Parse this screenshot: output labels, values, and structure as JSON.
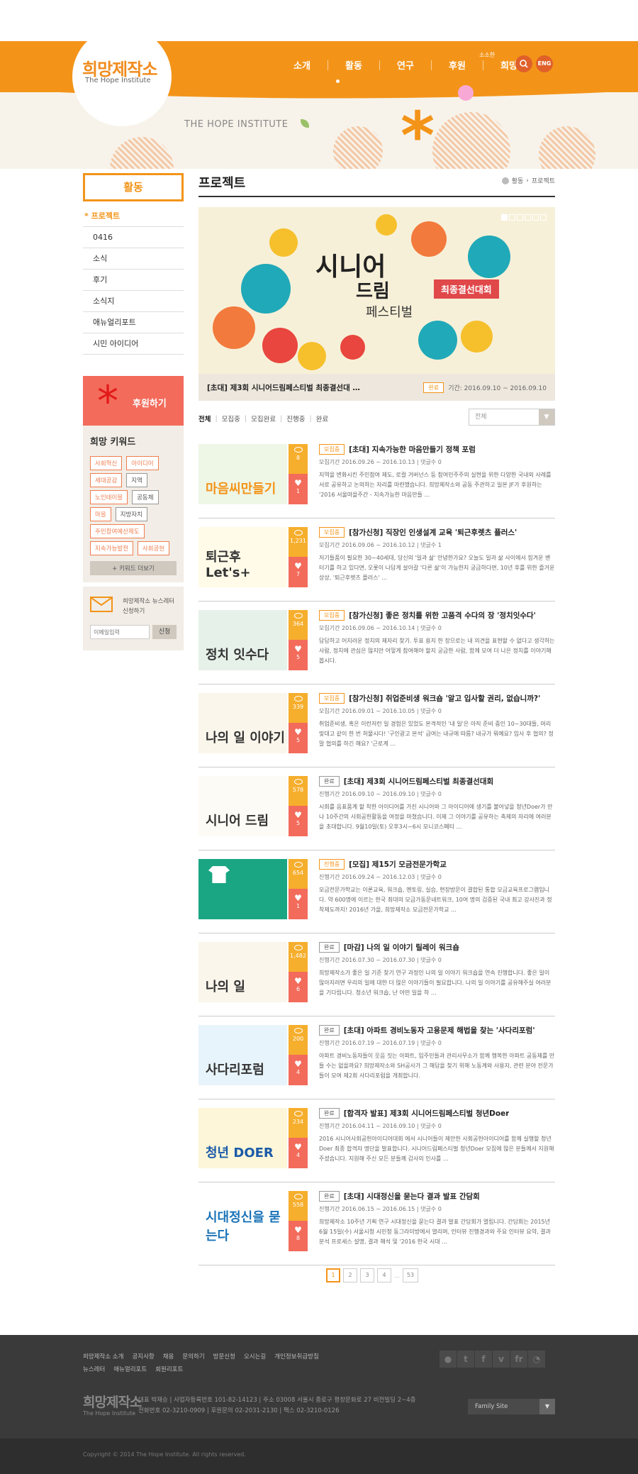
{
  "header": {
    "logo": "희망제작소",
    "logo_sub": "The Hope Institute",
    "nav": [
      "소개",
      "활동",
      "연구",
      "후원"
    ],
    "nav_small": "소소한",
    "nav_last": "희망",
    "search_icon": "search-icon",
    "lang": "ENG",
    "banner": "THE HOPE INSTITUTE"
  },
  "sidebar": {
    "title": "활동",
    "items": [
      "프로젝트",
      "0416",
      "소식",
      "후기",
      "소식지",
      "애뉴얼리포트",
      "시민 아이디어"
    ],
    "support": "후원하기",
    "keyword_title": "희망 키워드",
    "keywords": [
      "사회혁신",
      "아이디어",
      "세대공감",
      "지역",
      "노인테이블",
      "공동체",
      "마을",
      "지방자치",
      "주민참여예산제도",
      "지속가능발전",
      "사회공헌"
    ],
    "more_keywords": "+ 키워드 더보기",
    "newsletter": "희망제작소 뉴스레터 신청하기",
    "email_placeholder": "이메일입력",
    "subscribe": "신청"
  },
  "content": {
    "title": "프로젝트",
    "breadcrumb": [
      "활동",
      "프로젝트"
    ],
    "slider": {
      "main": "시니어",
      "sub": "드림",
      "sub2": "페스티벌",
      "badge": "최종결선대회",
      "caption": "[초대] 제3회 시니어드림페스티벌 최종결선대 …",
      "status": "완료",
      "period": "기간: 2016.09.10 ~ 2016.09.10"
    },
    "filters": [
      "전체",
      "모집중",
      "모집완료",
      "진행중",
      "완료"
    ],
    "filter_select": "전체",
    "posts": [
      {
        "status": "모집중",
        "title": "[초대] 지속가능한 마음만들기 정책 포럼",
        "meta": "모집기간 2016.09.26 ~ 2016.10.13  |  댓글수 0",
        "desc": "지역을 변화시킨 주민참여 제도, 로컬 거버넌스 등 참여민주주의 실현을 위한 다양한 국내외 사례를 서로 공유하고 논의하는 자리를 마련했습니다. 희망제작소와 공동 주관하고 일본 JF가 후원하는 '2016 서울마을주간 - 지속가능한 마음만들 …",
        "views": "8",
        "likes": "1",
        "thumb": "마음씨만들기",
        "colors": [
          "#eef6e6",
          "#f39419"
        ]
      },
      {
        "status": "모집중",
        "title": "[참가신청] 직장인 인생설계 교육 '퇴근후렛츠 플러스'",
        "meta": "모집기간 2016.09.06 ~ 2016.10.12  |  댓글수 1",
        "desc": "저기들품이 필요한 30~40세대, 당신의 '일과 삶' 안녕한가요? 오늘도 일과 삶 사이에서 힘겨운 밴터기를 하고 있다면, 오롯이 나답게 살아갈 '다른 삶'이 가능한지 궁금하다면, 10년 후를 위한 즐거운 상상, '퇴근후렛츠 플러스' …",
        "views": "1,231",
        "likes": "7",
        "thumb": "퇴근후 Let's+",
        "colors": [
          "#fffbe8",
          "#333"
        ]
      },
      {
        "status": "모집중",
        "title": "[참가신청] 좋은 정치를 위한 고품격 수다의 장 '정치잇수다'",
        "meta": "모집기간 2016.09.06 ~ 2016.10.14  |  댓글수 0",
        "desc": "답답하고 어지러운 정치의 제자리 찾기. 투표 용지 한 장으로는 내 의견을 표현할 수 없다고 생각하는 사람, 정치에 관심은 많지만 어떻게 참여해야 할지 궁금한 사람, 함께 모여 더 나은 정치를 이야기해봅시다.",
        "views": "364",
        "likes": "5",
        "thumb": "정치 잇수다",
        "colors": [
          "#e6f1ea",
          "#333"
        ]
      },
      {
        "status": "모집중",
        "title": "[참가신청] 취업준비생 워크숍 '알고 입사할 권리, 없습니까?'",
        "meta": "모집기간 2016.09.01 ~ 2016.10.05  |  댓글수 0",
        "desc": "취업준비생, 혹은 이런저런 일 경험은 있었도 본격적인 '내 일'은 아직 준비 중인 10~30대들, 머리 맞대고 같이 한 번 허물시다! '구인광고 본석' 급여는 내규에 따름? 내규가 뭐예요? 입사 후 협의? 정말 협의를 하긴 해요? '근로계 …",
        "views": "339",
        "likes": "5",
        "thumb": "나의 일 이야기",
        "colors": [
          "#fbf6ec",
          "#333"
        ]
      },
      {
        "status": "완료",
        "title": "[초대] 제3회 시니어드림페스티벌 최종결선대회",
        "meta": "진행기간 2016.09.10 ~ 2016.09.10  |  댓글수 0",
        "desc": "시회를 음표품계 할 착한 아이디어를 가진 시니어와 그 아이디어에 생기를 불어넣을 청년Doer가 만나 10주간의 사회공헌활동을 여정을 마쳤습니다. 이제 그 이야기를 공유하는 축제의 자리에 여러분을 초대합니다. 9월10일(토) 오후3시~6시 모니코스페티 …",
        "views": "578",
        "likes": "5",
        "thumb": "시니어 드림",
        "colors": [
          "#fdfbf5",
          "#333"
        ]
      },
      {
        "status": "진행중",
        "title": "[모집] 제15기 모금전문가학교",
        "meta": "진행기간 2016.09.24 ~ 2016.12.03  |  댓글수 0",
        "desc": "모금전문가학교는 이론교육, 워크숍, 멘토링, 실습, 현장방문이 결합된 통합 모금교육프로그램입니다. 약 600명에 이르는 한국 최대의 모금가동문네트워크, 10여 명의 검증된 국내 최고 강사진과 정착제도까지! 2016년 가을, 희망제작소 모금전문가학교 …",
        "views": "654",
        "likes": "1",
        "thumb": "",
        "colors": [
          "#1aa683",
          "#fff"
        ]
      },
      {
        "status": "완료",
        "title": "[마감] 나의 일 이야기 릴레이 워크숍",
        "meta": "진행기간 2016.07.30 ~ 2016.07.30  |  댓글수 0",
        "desc": "희망제작소가 좋은 일 기준 찾기 연구 과정인 나의 일 이야기 워크숍을 연속 진행합니다. 좋은 일이 많아지려면 우리의 일에 대한 더 많은 이야기들이 필요합니다. 나의 일 이야기를 공유해주실 여러분을 기다립니다. 청소년 워크숍, 난 어떤 일을 하 …",
        "views": "1,482",
        "likes": "6",
        "thumb": "나의 일",
        "colors": [
          "#fbf6ec",
          "#333"
        ]
      },
      {
        "status": "완료",
        "title": "[초대] 아파트 경비노동자 고용문제 해법을 찾는 '사다리포럼'",
        "meta": "진행기간 2016.07.19 ~ 2016.07.19  |  댓글수 0",
        "desc": "아파트 경비노동자들이 웃음 짓는 아파트, 입주민들과 관리사무소가 함께 행복한 아파트 공동체를 만들 수는 없을까요? 희망제작소와 SH공사가 그 해답을 찾기 위해 노동계와 사용자, 관련 분야 전문가들이 모여 제2회 사다리포럼을 개최합니다.",
        "views": "200",
        "likes": "4",
        "thumb": "사다리포럼",
        "colors": [
          "#e8f4fb",
          "#333"
        ]
      },
      {
        "status": "완료",
        "title": "[합격자 발표] 제3회 시니어드림페스티벌 청년Doer",
        "meta": "진행기간 2016.04.11 ~ 2016.09.10  |  댓글수 0",
        "desc": "2016 시니어사회공헌아이디어대회 에서 시니어들이 제안한 사회공헌아이디어를 함께 실행할 청년Doer 최종 합격자 명단을 발표합니다. 시니어드림페스티벌 청년Doer 모집에 많은 분들께서 지원해 주셨습니다. 지원해 주신 모든 분들께 감사의 인사를 …",
        "views": "234",
        "likes": "4",
        "thumb": "청년 DOER",
        "colors": [
          "#fdf6d8",
          "#1a5aa8"
        ]
      },
      {
        "status": "완료",
        "title": "[초대] 시대정신을 묻는다 결과 발표 간담회",
        "meta": "진행기간 2016.06.15 ~ 2016.06.15  |  댓글수 0",
        "desc": "희망제작소 10주년 기획 연구 시대정신을 묻는다 결과 발표 간담회가 열립니다. 간담회는 2015년 6월 15일(수) 서울시청 시민청 동그라미방에서 열리며, 인터뷰 진행경과와 주요 인터뷰 요약, 결과 분석 프로세스 설명, 결과 해석 및 '2016 한국 시대 …",
        "views": "558",
        "likes": "8",
        "thumb": "시대정신을 묻는다",
        "colors": [
          "#ffffff",
          "#1a73b8"
        ]
      }
    ],
    "pagination": [
      "1",
      "2",
      "3",
      "4",
      "…",
      "53"
    ]
  },
  "footer": {
    "links1": [
      "희망제작소 소개",
      "공지사항",
      "채용",
      "문의하기",
      "방문신청",
      "오시는길",
      "개인정보취급방침"
    ],
    "links2": [
      "뉴스레터",
      "애뉴얼리포트",
      "회원리포트"
    ],
    "social": [
      "talk-icon",
      "twitter-icon",
      "facebook-icon",
      "vimeo-icon",
      "flickr-icon",
      "rss-icon"
    ],
    "logo": "희망제작소",
    "logo_sub": "The Hope Institute",
    "info1": "대표 박재승  |  사업자등록번호 101-82-14123  |  주소 03008 서울시 종로구 평창문화로 27 비전빌딩 2~4층",
    "info2": "전화번호 02-3210-0909  |  후원문의 02-2031-2130  |  팩스 02-3210-0126",
    "family_site": "Family Site",
    "copyright": "Copyright © 2014 The Hope Institute. All rights reserved."
  },
  "colors": {
    "accent": "#f39419",
    "coral": "#f36b5b",
    "views": "#f6ae2d"
  }
}
